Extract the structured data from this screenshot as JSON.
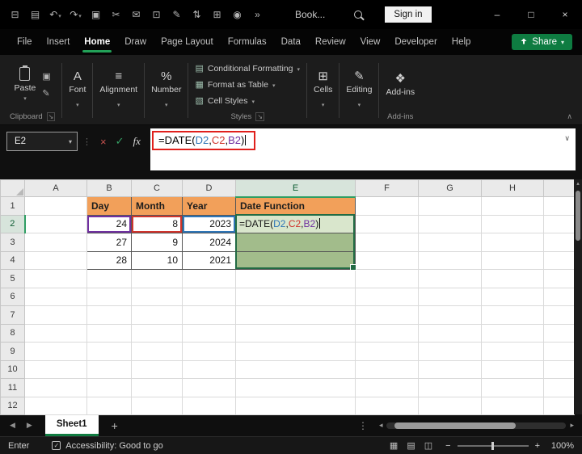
{
  "colors": {
    "excel_green": "#107C41",
    "tab_underline_green": "#22A158",
    "header_fill_orange": "#F2A05A",
    "result_fill_light": "#D9E6CC",
    "result_fill_dark": "#A2BC8B",
    "ref_blue": "#2E75B6",
    "ref_red": "#D0342C",
    "ref_purple": "#7030A0",
    "annotation_red": "#E0201C"
  },
  "window": {
    "qat": [
      {
        "name": "app-menu",
        "glyph": "⊟"
      },
      {
        "name": "save",
        "glyph": "▤"
      },
      {
        "name": "undo",
        "glyph": "↶"
      },
      {
        "name": "redo",
        "glyph": "↷"
      },
      {
        "name": "copy",
        "glyph": "▣"
      },
      {
        "name": "cut",
        "glyph": "✂"
      },
      {
        "name": "email",
        "glyph": "✉"
      },
      {
        "name": "print",
        "glyph": "⊡"
      },
      {
        "name": "format-painter",
        "glyph": "✎"
      },
      {
        "name": "sort",
        "glyph": "⇅"
      },
      {
        "name": "merge-cells",
        "glyph": "⊞"
      },
      {
        "name": "camera",
        "glyph": "◉"
      },
      {
        "name": "more-commands",
        "glyph": "»"
      }
    ],
    "workbook_name": "Book...",
    "signin_label": "Sign in",
    "controls": {
      "minimize": "–",
      "maximize": "□",
      "close": "×"
    }
  },
  "menubar": {
    "tabs": [
      "File",
      "Insert",
      "Home",
      "Draw",
      "Page Layout",
      "Formulas",
      "Data",
      "Review",
      "View",
      "Developer",
      "Help"
    ],
    "active_tab": "Home",
    "share_label": "Share"
  },
  "ribbon": {
    "paste_label": "Paste",
    "copy_glyph": "▣",
    "format_painter_glyph": "✎",
    "clipboard_group": "Clipboard",
    "font_label": "Font",
    "font_glyph": "A",
    "alignment_label": "Alignment",
    "alignment_glyph": "≡",
    "number_label": "Number",
    "number_glyph": "%",
    "styles_items": [
      {
        "label": "Conditional Formatting",
        "glyph": "▤"
      },
      {
        "label": "Format as Table",
        "glyph": "▦"
      },
      {
        "label": "Cell Styles",
        "glyph": "▧"
      }
    ],
    "styles_group": "Styles",
    "cells_label": "Cells",
    "cells_glyph": "⊞",
    "editing_label": "Editing",
    "editing_glyph": "✎",
    "addins_label": "Add-ins",
    "addins_glyph": "❖",
    "addins_group": "Add-ins"
  },
  "formula_bar": {
    "name_box": "E2",
    "cancel": "×",
    "enter": "✓",
    "fx": "fx",
    "formula": {
      "p1": "=DATE(",
      "r1": "D2",
      "c1": ",",
      "r2": "C2",
      "c2": ",",
      "r3": "B2",
      "p2": ")"
    }
  },
  "grid": {
    "columns": [
      "A",
      "B",
      "C",
      "D",
      "E",
      "F",
      "G",
      "H"
    ],
    "rows": [
      "1",
      "2",
      "3",
      "4",
      "5",
      "6",
      "7",
      "8",
      "9",
      "10",
      "11",
      "12"
    ],
    "active_cell": "E2",
    "cells": {
      "B1": "Day",
      "C1": "Month",
      "D1": "Year",
      "E1": "Date Function",
      "B2": "24",
      "C2": "8",
      "D2": "2023",
      "B3": "27",
      "C3": "9",
      "D3": "2024",
      "B4": "28",
      "C4": "10",
      "D4": "2021"
    }
  },
  "sheetbar": {
    "prev": "◀",
    "next": "▶",
    "tab": "Sheet1",
    "add": "+",
    "dots": "⋮"
  },
  "statusbar": {
    "mode": "Enter",
    "accessibility": "Accessibility: Good to go",
    "views": [
      {
        "name": "normal-view",
        "glyph": "▦"
      },
      {
        "name": "page-layout-view",
        "glyph": "▤"
      },
      {
        "name": "page-break-view",
        "glyph": "◫"
      }
    ],
    "zoom_minus": "−",
    "zoom_plus": "+",
    "zoom_value": "100%"
  }
}
